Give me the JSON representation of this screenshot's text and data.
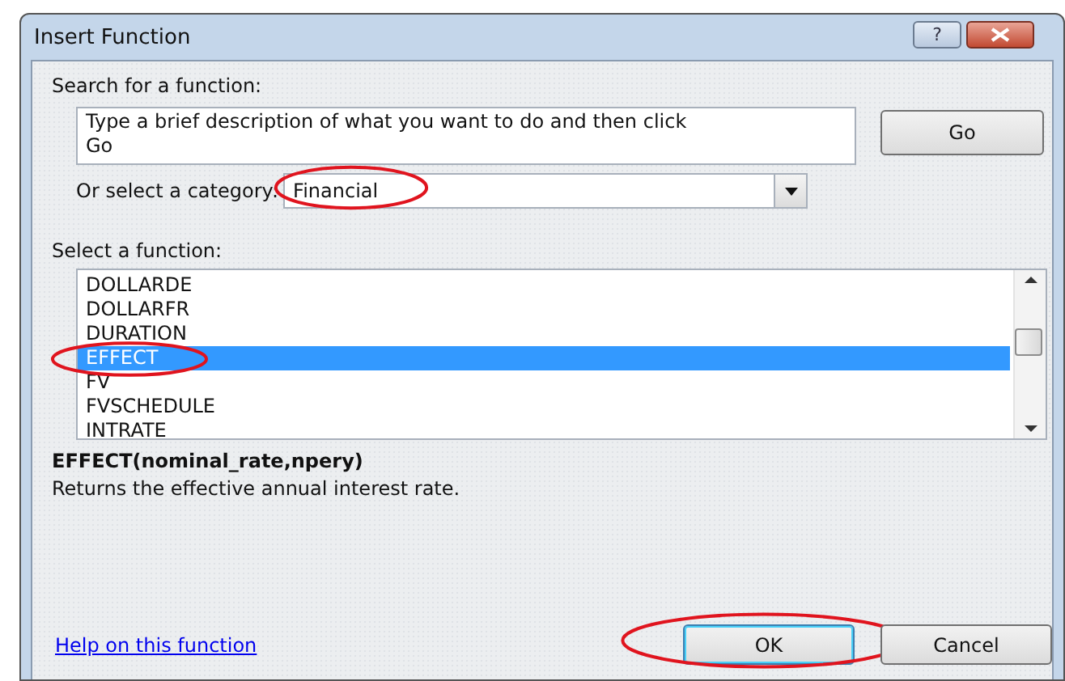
{
  "window": {
    "title": "Insert Function",
    "help_glyph": "?"
  },
  "search": {
    "label": "Search for a function:",
    "value": "Type a brief description of what you want to do and then click Go",
    "go_button": "Go"
  },
  "category": {
    "label": "Or select a category:",
    "value": "Financial",
    "circled": true
  },
  "functions": {
    "label": "Select a function:",
    "items": [
      {
        "name": "DOLLARDE",
        "selected": false,
        "circled": false
      },
      {
        "name": "DOLLARFR",
        "selected": false,
        "circled": false
      },
      {
        "name": "DURATION",
        "selected": false,
        "circled": false
      },
      {
        "name": "EFFECT",
        "selected": true,
        "circled": true
      },
      {
        "name": "FV",
        "selected": false,
        "circled": false
      },
      {
        "name": "FVSCHEDULE",
        "selected": false,
        "circled": false
      },
      {
        "name": "INTRATE",
        "selected": false,
        "circled": false
      }
    ]
  },
  "syntax": "EFFECT(nominal_rate,npery)",
  "description": "Returns the effective annual interest rate.",
  "help_link": "Help on this function",
  "buttons": [
    {
      "label": "OK",
      "kind": "default",
      "circled": true
    },
    {
      "label": "Cancel",
      "kind": "normal",
      "circled": false
    }
  ]
}
